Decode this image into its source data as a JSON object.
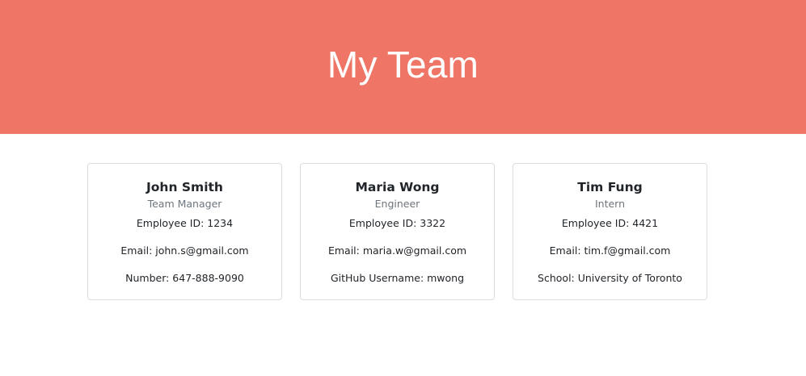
{
  "header": {
    "title": "My Team"
  },
  "team": [
    {
      "name": "John Smith",
      "role": "Team Manager",
      "id_label": "Employee ID: 1234",
      "email_label": "Email: john.s@gmail.com",
      "extra_label": "Number: 647-888-9090"
    },
    {
      "name": "Maria Wong",
      "role": "Engineer",
      "id_label": "Employee ID: 3322",
      "email_label": "Email: maria.w@gmail.com",
      "extra_label": "GitHub Username: mwong"
    },
    {
      "name": "Tim Fung",
      "role": "Intern",
      "id_label": "Employee ID: 4421",
      "email_label": "Email: tim.f@gmail.com",
      "extra_label": "School: University of Toronto"
    }
  ],
  "colors": {
    "header_bg": "#ef7667",
    "header_text": "#ffffff",
    "muted_text": "#6c757d",
    "card_border": "#dadde1"
  }
}
